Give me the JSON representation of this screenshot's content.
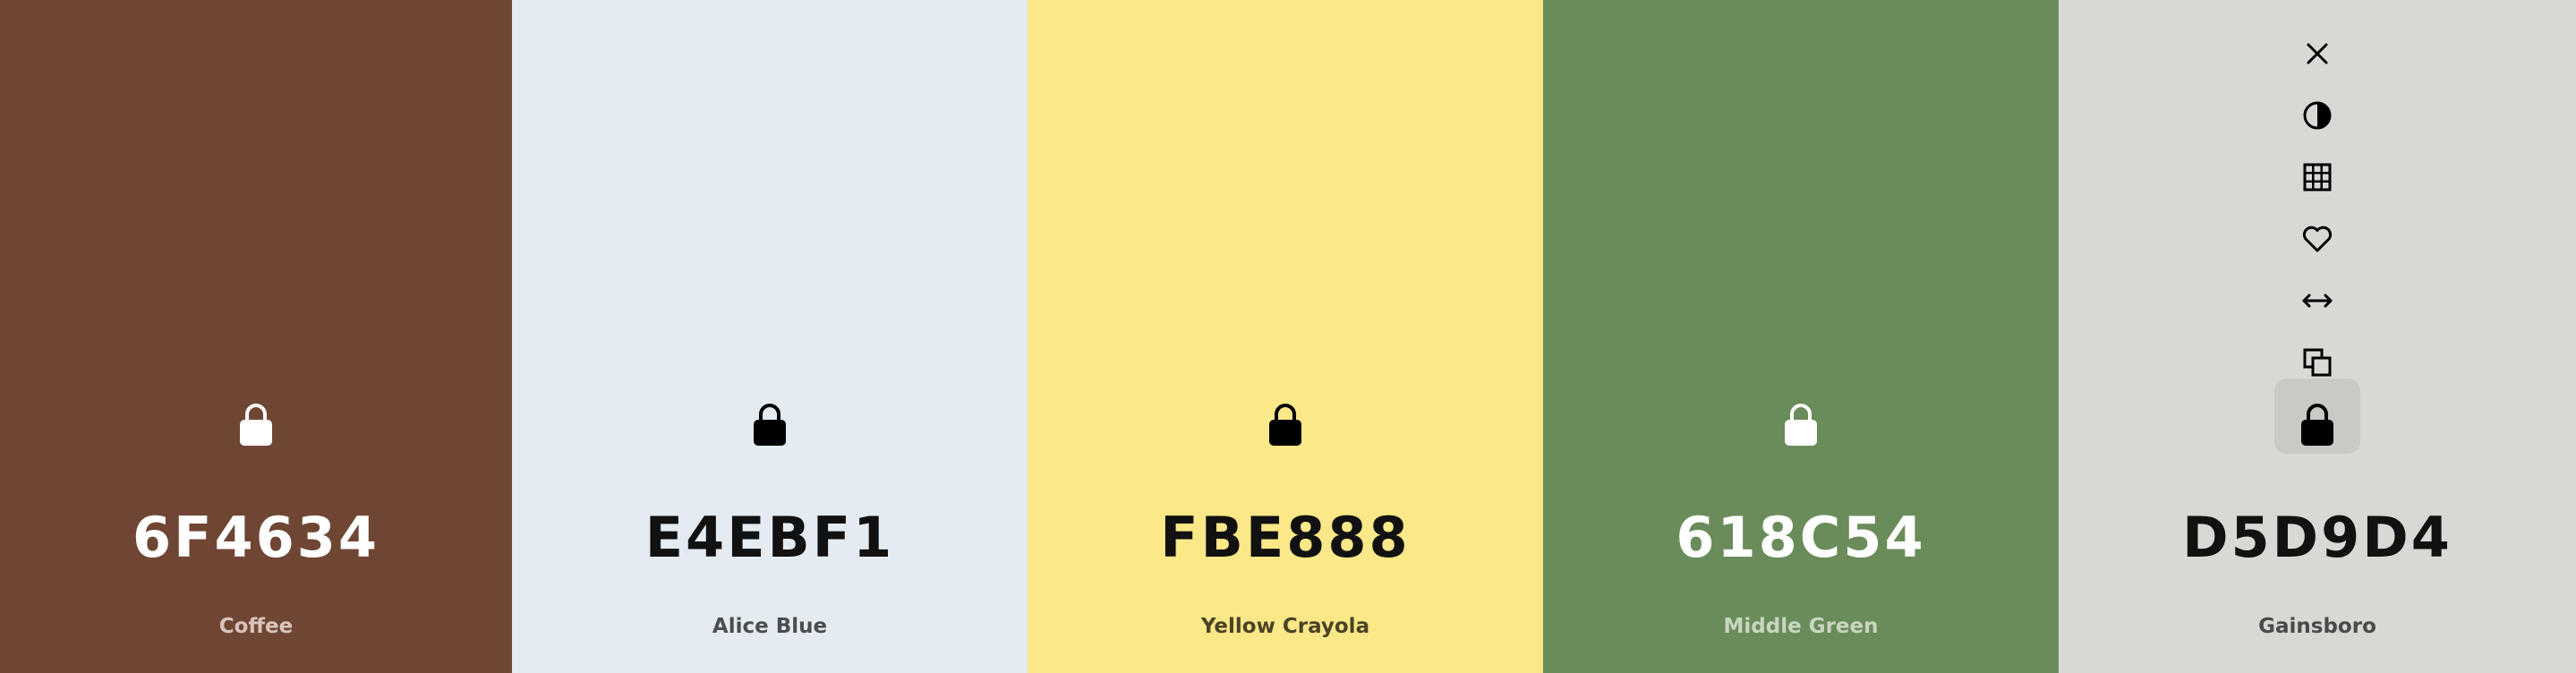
{
  "swatches": [
    {
      "hex": "6F4634",
      "name": "Coffee",
      "bg": "#6F4634",
      "text_color": "#FFFFFF",
      "name_color": "#D9C4BC",
      "lock_color": "#FFFFFF",
      "lock_icon": "lock-icon"
    },
    {
      "hex": "E4EBF1",
      "name": "Alice Blue",
      "bg": "#E4EBF1",
      "text_color": "#111111",
      "name_color": "#4A4D52",
      "lock_color": "#000000",
      "lock_icon": "lock-icon"
    },
    {
      "hex": "FBE888",
      "name": "Yellow Crayola",
      "bg": "#FBE888",
      "text_color": "#111111",
      "name_color": "#4A4426",
      "lock_color": "#000000",
      "lock_icon": "lock-icon"
    },
    {
      "hex": "618C54",
      "name": "Middle Green",
      "bg": "#6A8C5A",
      "text_color": "#FFFFFF",
      "name_color": "#C8D6C0",
      "lock_color": "#FFFFFF",
      "lock_icon": "lock-icon"
    },
    {
      "hex": "D5D9D4",
      "name": "Gainsboro",
      "bg": "#D8D9D4",
      "text_color": "#111111",
      "name_color": "#4A4B48",
      "lock_color": "#000000",
      "lock_icon": "lock-icon"
    }
  ],
  "active_toolbar": {
    "icons": [
      "close-icon",
      "contrast-icon",
      "shades-grid-icon",
      "heart-icon",
      "drag-arrows-icon",
      "copy-icon"
    ],
    "lock_highlight_color": "#C9CAC6"
  }
}
